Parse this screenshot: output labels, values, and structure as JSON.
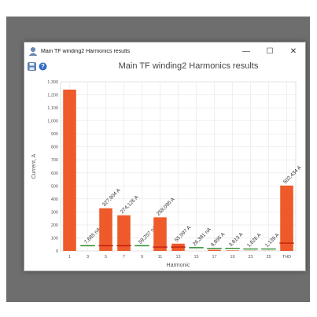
{
  "window": {
    "title": "Main TF winding2 Harmonics results",
    "minimize_glyph": "—",
    "maximize_glyph": "☐",
    "close_glyph": "✕"
  },
  "toolbar": {
    "icons": [
      "save-icon",
      "help-icon"
    ]
  },
  "colors": {
    "bar": "#ee5a2a",
    "limit": "#2e8b2e",
    "limit_on_bar": "#c02010",
    "grid": "#e6e6e6"
  },
  "chart_data": {
    "type": "bar",
    "title": "Main TF winding2 Harmonics results",
    "xlabel": "Harmonic",
    "ylabel": "Current, A",
    "ylim": [
      0,
      1300
    ],
    "yticks": [
      "0",
      "100",
      "200",
      "300",
      "400",
      "500",
      "600",
      "700",
      "800",
      "900",
      "1,000",
      "1,100",
      "1,200",
      "1,300"
    ],
    "categories": [
      "1",
      "3",
      "5",
      "7",
      "9",
      "11",
      "13",
      "15",
      "17",
      "19",
      "23",
      "25",
      "THD"
    ],
    "values": [
      1240,
      7.685e-06,
      327.804,
      274.126,
      5.9257e-05,
      258.095,
      55.997,
      2.6381e-05,
      8.895,
      3.813,
      1.626,
      1.139,
      502.434
    ],
    "labels": [
      "",
      "7,685 nA",
      "327,804 A",
      "274,126 A",
      "59,257 nA",
      "258,095 A",
      "55,997 A",
      "26,381 nA",
      "8,895 A",
      "3,813 A",
      "1,626 A",
      "1,139 A",
      "502,434 A"
    ],
    "limits": [
      null,
      40,
      40,
      40,
      40,
      30,
      30,
      25,
      20,
      20,
      15,
      15,
      60
    ],
    "grid": true
  }
}
